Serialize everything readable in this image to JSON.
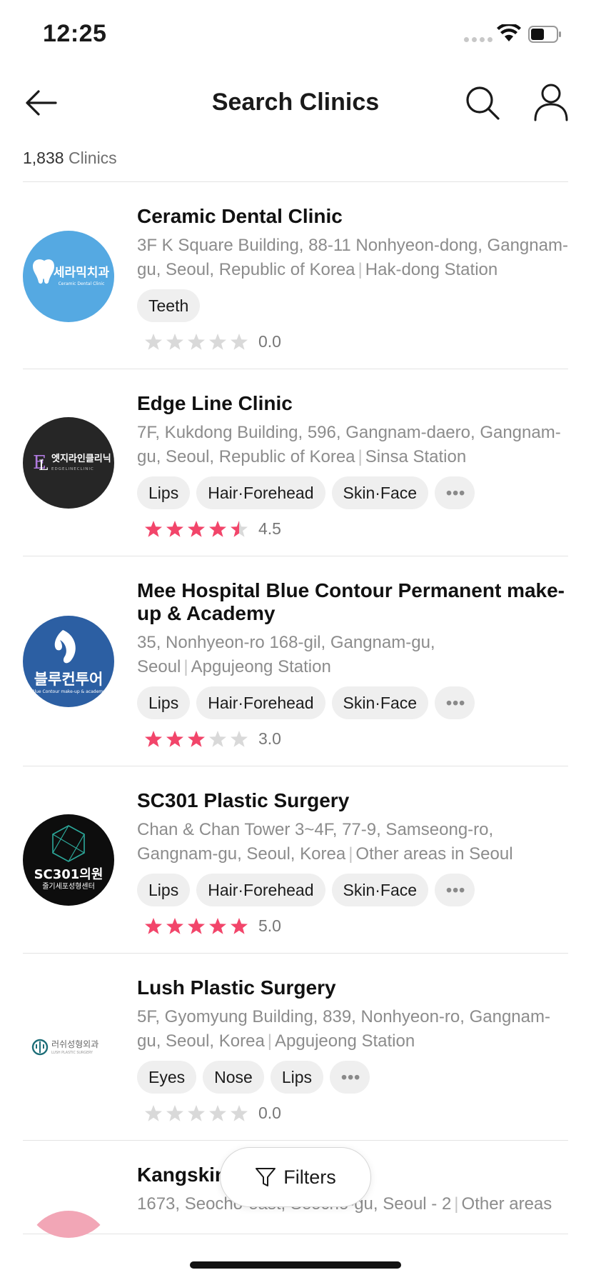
{
  "status_bar": {
    "time": "12:25"
  },
  "header": {
    "title": "Search Clinics"
  },
  "count": {
    "number": "1,838",
    "label": "Clinics"
  },
  "colors": {
    "star_on": "#f2456a",
    "star_off": "#d9d9d9",
    "accent": "#f2456a"
  },
  "clinics": [
    {
      "name": "Ceramic Dental Clinic",
      "address": "3F K Square Building, 88-11 Nonhyeon-dong, Gangnam-gu, Seoul, Republic of Korea",
      "station": "Hak-dong Station",
      "tags": [
        "Teeth"
      ],
      "more": false,
      "rating": 0.0,
      "score": "0.0",
      "logo": {
        "style": "ceramic",
        "text_kr": "세라믹치과",
        "text_en": "Ceramic Dental Clinic"
      }
    },
    {
      "name": "Edge Line Clinic",
      "address": "7F, Kukdong Building, 596, Gangnam-daero, Gangnam-gu, Seoul, Republic of Korea",
      "station": "Sinsa Station",
      "tags": [
        "Lips",
        "Hair·Forehead",
        "Skin·Face"
      ],
      "more": true,
      "rating": 4.5,
      "score": "4.5",
      "logo": {
        "style": "edge",
        "text_kr": "엣지라인클리닉",
        "text_en": "EDGELINECLINIC"
      }
    },
    {
      "name": "Mee Hospital Blue Contour Permanent make-up & Academy",
      "address": "35, Nonhyeon-ro 168-gil, Gangnam-gu, Seoul",
      "station": "Apgujeong Station",
      "tags": [
        "Lips",
        "Hair·Forehead",
        "Skin·Face"
      ],
      "more": true,
      "rating": 3.0,
      "score": "3.0",
      "logo": {
        "style": "blue",
        "text_kr": "블루컨투어",
        "text_en": "Blue Contour make-up & academy"
      }
    },
    {
      "name": "SC301 Plastic Surgery",
      "address": "Chan & Chan Tower 3~4F, 77-9, Samseong-ro, Gangnam-gu, Seoul, Korea",
      "station": "Other areas in Seoul",
      "tags": [
        "Lips",
        "Hair·Forehead",
        "Skin·Face"
      ],
      "more": true,
      "rating": 5.0,
      "score": "5.0",
      "logo": {
        "style": "sc301",
        "text_kr": "SC301의원",
        "text_en": "줄기세포성형센터"
      }
    },
    {
      "name": "Lush Plastic Surgery",
      "address": "5F, Gyomyung Building, 839, Nonhyeon-ro, Gangnam-gu, Seoul, Korea",
      "station": "Apgujeong Station",
      "tags": [
        "Eyes",
        "Nose",
        "Lips"
      ],
      "more": true,
      "rating": 0.0,
      "score": "0.0",
      "logo": {
        "style": "lush",
        "text_kr": "러쉬성형외과",
        "text_en": "LUSH PLASTIC SURGERY"
      }
    },
    {
      "name": "Kangskin",
      "address": "1673, Seocho-east, Seocho-gu, Seoul - 2",
      "station": "Other areas",
      "tags": [],
      "more": false,
      "rating": null,
      "score": "",
      "logo": {
        "style": "kang",
        "text_kr": "",
        "text_en": ""
      }
    }
  ],
  "filters": {
    "label": "Filters"
  }
}
